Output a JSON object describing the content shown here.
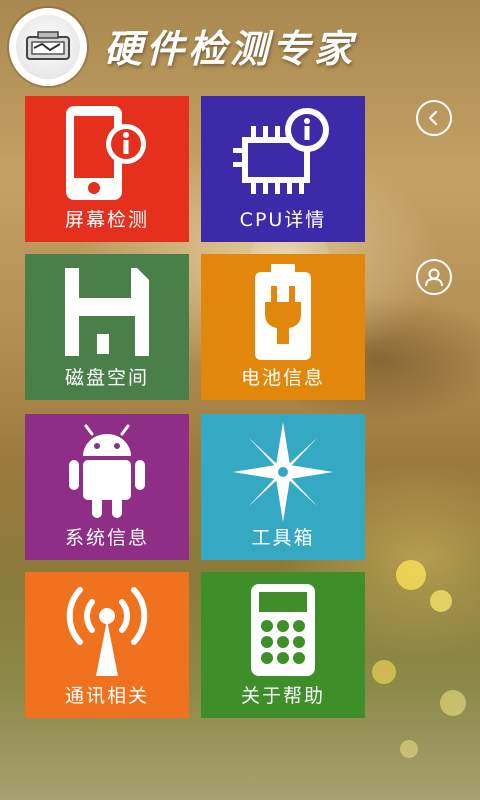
{
  "app": {
    "title": "硬件检测专家"
  },
  "tiles": [
    {
      "label": "屏幕检测",
      "icon": "phone-info-icon",
      "color": "#e4301c"
    },
    {
      "label": "CPU详情",
      "icon": "chip-info-icon",
      "color": "#3d2aa8"
    },
    {
      "label": "磁盘空间",
      "icon": "floppy-disk-icon",
      "color": "#4b7f4a"
    },
    {
      "label": "电池信息",
      "icon": "battery-plug-icon",
      "color": "#e3870c"
    },
    {
      "label": "系统信息",
      "icon": "android-icon",
      "color": "#8f2e86"
    },
    {
      "label": "工具箱",
      "icon": "compass-star-icon",
      "color": "#35a9c4"
    },
    {
      "label": "通讯相关",
      "icon": "signal-tower-icon",
      "color": "#f0711e"
    },
    {
      "label": "关于帮助",
      "icon": "calculator-icon",
      "color": "#3e8e2a"
    }
  ],
  "side_buttons": [
    {
      "icon": "back-arrow-icon"
    },
    {
      "icon": "user-profile-icon"
    }
  ]
}
